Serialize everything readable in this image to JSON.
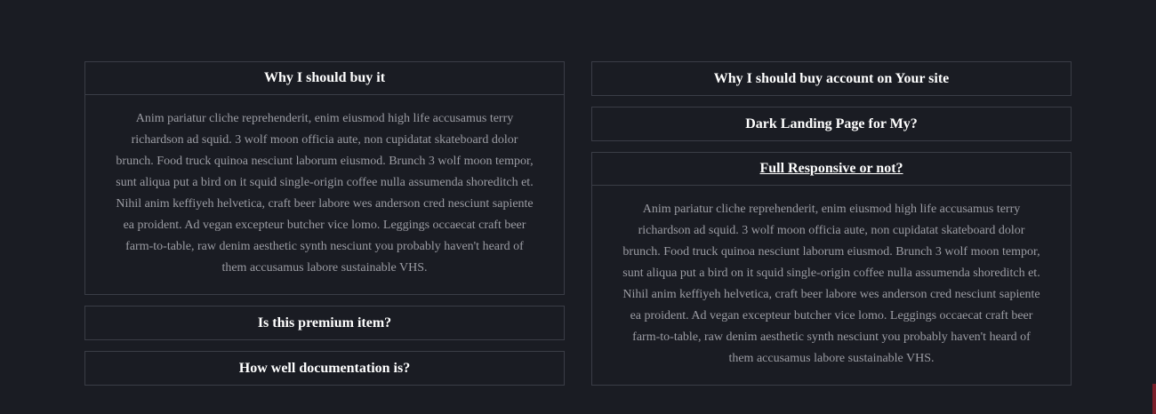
{
  "left_column": {
    "items": [
      {
        "title": "Why I should buy it",
        "body": "Anim pariatur cliche reprehenderit, enim eiusmod high life accusamus terry richardson ad squid. 3 wolf moon officia aute, non cupidatat skateboard dolor brunch. Food truck quinoa nesciunt laborum eiusmod. Brunch 3 wolf moon tempor, sunt aliqua put a bird on it squid single-origin coffee nulla assumenda shoreditch et. Nihil anim keffiyeh helvetica, craft beer labore wes anderson cred nesciunt sapiente ea proident. Ad vegan excepteur butcher vice lomo. Leggings occaecat craft beer farm-to-table, raw denim aesthetic synth nesciunt you probably haven't heard of them accusamus labore sustainable VHS."
      },
      {
        "title": "Is this premium item?"
      },
      {
        "title": "How well documentation is?"
      }
    ]
  },
  "right_column": {
    "items": [
      {
        "title": "Why I should buy account on Your site"
      },
      {
        "title": "Dark Landing Page for My?"
      },
      {
        "title": "Full Responsive or not?",
        "body": "Anim pariatur cliche reprehenderit, enim eiusmod high life accusamus terry richardson ad squid. 3 wolf moon officia aute, non cupidatat skateboard dolor brunch. Food truck quinoa nesciunt laborum eiusmod. Brunch 3 wolf moon tempor, sunt aliqua put a bird on it squid single-origin coffee nulla assumenda shoreditch et. Nihil anim keffiyeh helvetica, craft beer labore wes anderson cred nesciunt sapiente ea proident. Ad vegan excepteur butcher vice lomo. Leggings occaecat craft beer farm-to-table, raw denim aesthetic synth nesciunt you probably haven't heard of them accusamus labore sustainable VHS."
      }
    ]
  },
  "colors": {
    "background": "#1a1c23",
    "border": "#3a3d46",
    "heading": "#ffffff",
    "body_text": "#9b9ca3",
    "scroll_marker": "#7a1f2a"
  }
}
